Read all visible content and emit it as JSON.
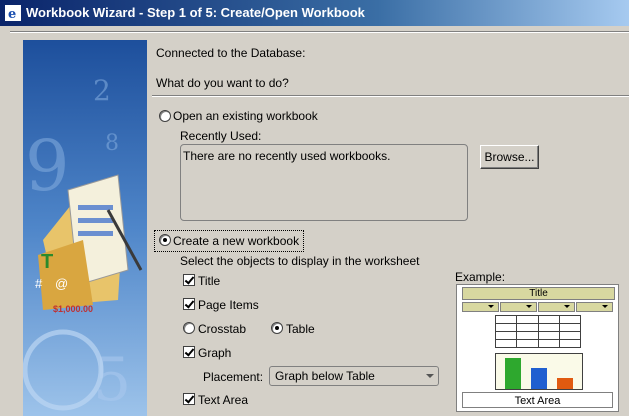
{
  "window": {
    "title": "Workbook Wizard - Step 1 of 5: Create/Open Workbook"
  },
  "header": {
    "connected": "Connected to the Database:",
    "question": "What do you want to do?"
  },
  "open_option": {
    "label": "Open an existing workbook",
    "recently_used_label": "Recently Used:",
    "recent_text": "There are no recently used workbooks.",
    "browse_label": "Browse..."
  },
  "create_option": {
    "label": "Create a new workbook",
    "select_objects": "Select the objects to display in the worksheet",
    "title_label": "Title",
    "page_items_label": "Page Items",
    "crosstab_label": "Crosstab",
    "table_label": "Table",
    "graph_label": "Graph",
    "placement_label": "Placement:",
    "placement_value": "Graph below Table",
    "text_area_label": "Text Area"
  },
  "example": {
    "label": "Example:",
    "title": "Title",
    "text_area": "Text Area",
    "bar_colors": [
      "#2ea82e",
      "#1f5fd0",
      "#e05a10"
    ]
  },
  "selected": {
    "mode": "create",
    "layout": "table"
  },
  "checked": {
    "title": true,
    "page_items": true,
    "graph": true,
    "text_area": true
  }
}
